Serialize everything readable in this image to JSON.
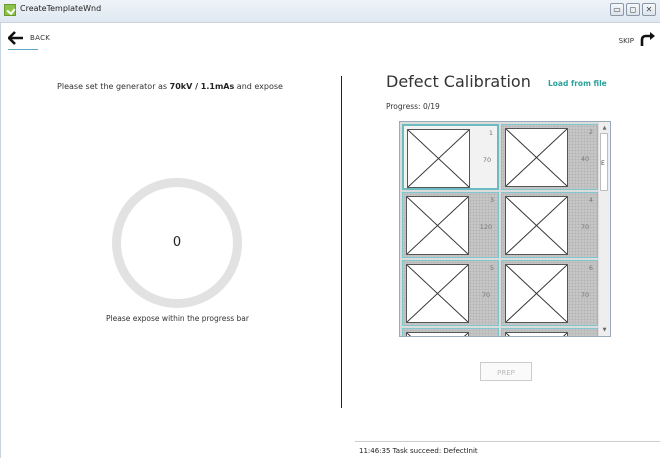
{
  "window": {
    "title": "CreateTemplateWnd",
    "buttons": [
      "▭",
      "◻",
      "✕"
    ]
  },
  "nav": {
    "back_label": "BACK",
    "skip_label": "SKIP"
  },
  "left": {
    "instruction_prefix": "Please set the generator as",
    "instruction_value": "70kV / 1.1mAs",
    "instruction_suffix": "and expose",
    "counter": "0",
    "expose_hint": "Please expose within the progress bar"
  },
  "right": {
    "title": "Defect Calibration",
    "load_label": "Load from file",
    "progress_label": "Progress:",
    "progress_value": "0/19",
    "tiles": [
      {
        "num": "1",
        "val": "70",
        "selected": true
      },
      {
        "num": "2",
        "val": "40",
        "selected": false
      },
      {
        "num": "3",
        "val": "120",
        "selected": false
      },
      {
        "num": "4",
        "val": "70",
        "selected": false
      },
      {
        "num": "5",
        "val": "70",
        "selected": false
      },
      {
        "num": "6",
        "val": "70",
        "selected": false
      },
      {
        "num": "",
        "val": "",
        "selected": false
      },
      {
        "num": "",
        "val": "",
        "selected": false
      }
    ],
    "scroll_mark": "E",
    "prep_label": "PREP"
  },
  "status": {
    "text": "11:46:35 Task succeed: DefectInit"
  },
  "colors": {
    "accent": "#2aa39a",
    "tile_border": "#7fc7cc"
  }
}
